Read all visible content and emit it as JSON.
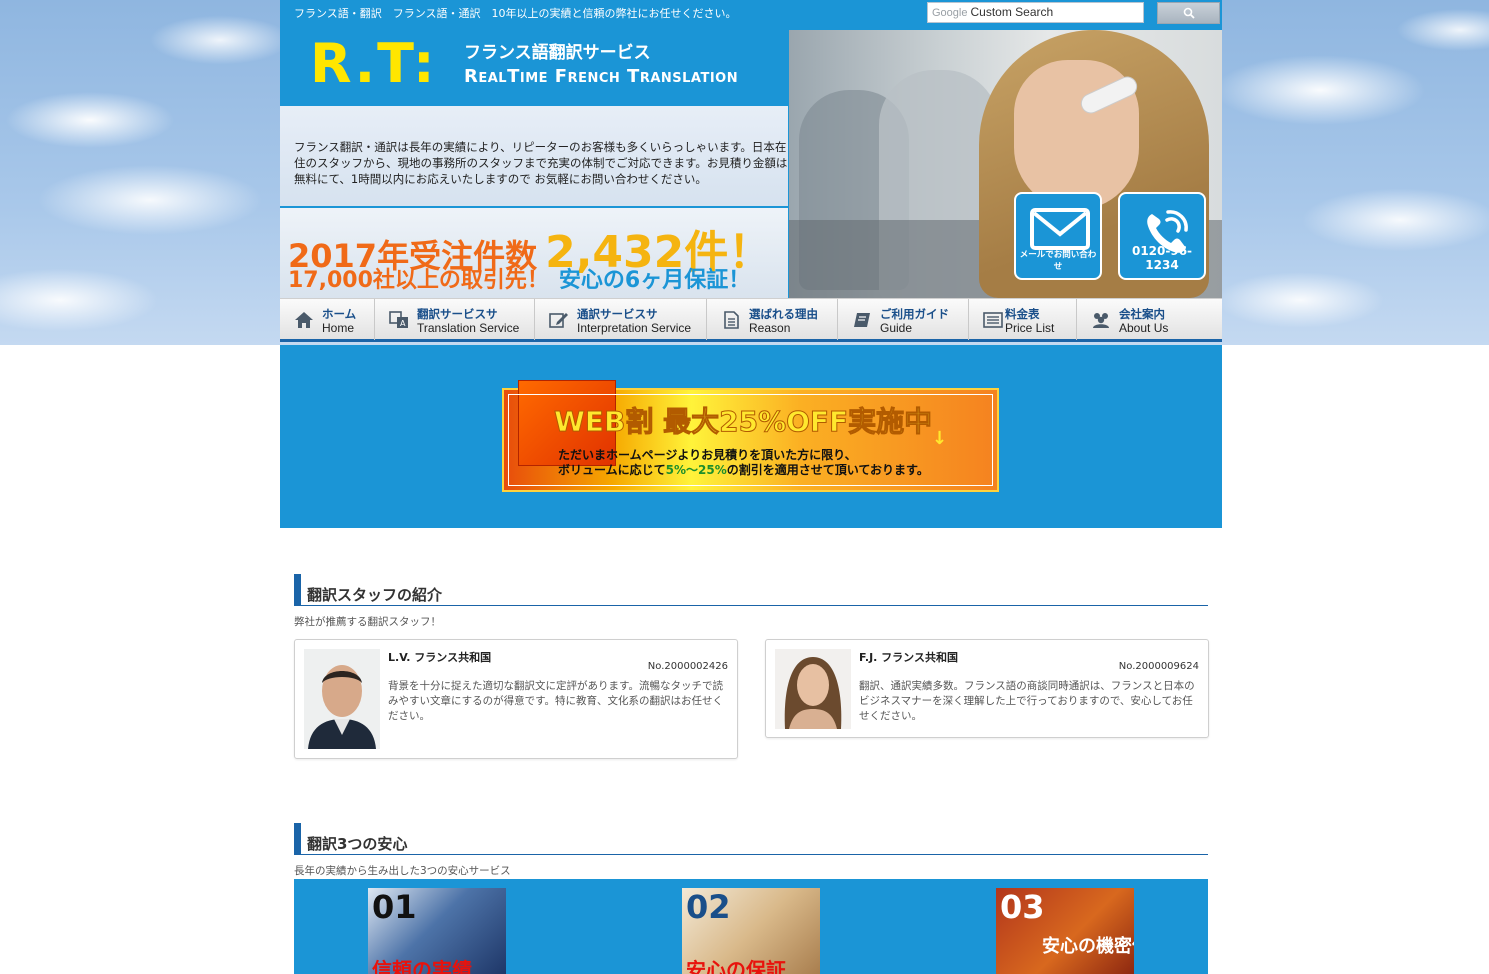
{
  "topbar": {
    "tagline": "フランス語・翻訳　フランス語・通訳　10年以上の実績と信頼の弊社にお任せください。",
    "search_brand": "Google",
    "search_placeholder": "Custom Search",
    "search_button_icon": "search-icon"
  },
  "header": {
    "logo_mark": "R.T:",
    "logo_jp": "フランス語翻訳サービス",
    "logo_en": "RealTime French Translation",
    "intro": "フランス翻訳・通訳は長年の実績により、リピーターのお客様も多くいらっしゃいます。日本在住のスタッフから、現地の事務所のスタッフまで充実の体制でご対応できます。お見積り金額は無料にて、1時間以内にお応えいたしますので お気軽にお問い合わせください。",
    "stat_orders_label": "2017年受注件数",
    "stat_orders_value": "2,432件！",
    "stat_clients": "17,000社以上の取引先！",
    "stat_guarantee": "安心の6ヶ月保証！",
    "mail_label": "メールでお問い合わせ",
    "tel_label": "0120-96-1234"
  },
  "nav": [
    {
      "jp": "ホーム",
      "en": "Home",
      "icon": "home-icon"
    },
    {
      "jp": "翻訳サービスサ",
      "en": "Translation Service",
      "icon": "translate-icon"
    },
    {
      "jp": "通訳サービスサ",
      "en": "Interpretation Service",
      "icon": "edit-icon"
    },
    {
      "jp": "選ばれる理由",
      "en": "Reason",
      "icon": "document-icon"
    },
    {
      "jp": "ご利用ガイド",
      "en": "Guide",
      "icon": "book-icon"
    },
    {
      "jp": "料金表",
      "en": "Price List",
      "icon": "list-icon"
    },
    {
      "jp": "会社案内",
      "en": "About Us",
      "icon": "people-icon"
    }
  ],
  "banner": {
    "title": "WEB割 最大25%OFF実施中",
    "line1": "ただいまホームページよりお見積りを頂いた方に限り、",
    "line2_a": "ボリュームに応じて",
    "line2_b": "5%～25%",
    "line2_c": "の割引を適用させて頂いております。"
  },
  "staff_section": {
    "title": "翻訳スタッフの紹介",
    "subtitle": "弊社が推薦する翻訳スタッフ！",
    "staff": [
      {
        "name": "L.V. フランス共和国",
        "no": "No.2000002426",
        "desc": "背景を十分に捉えた適切な翻訳文に定評があります。流暢なタッチで読みやすい文章にするのが得意です。特に教育、文化系の翻訳はお任せください。"
      },
      {
        "name": "F.J. フランス共和国",
        "no": "No.2000009624",
        "desc": "翻訳、通訳実績多数。フランス語の商談同時通訳は、フランスと日本のビジネスマナーを深く理解した上で行っておりますので、安心してお任せください。"
      }
    ]
  },
  "anshin_section": {
    "title": "翻訳3つの安心",
    "subtitle": "長年の実績から生み出した3つの安心サービス",
    "features": [
      {
        "num": "01",
        "caption": "信頼の実績"
      },
      {
        "num": "02",
        "caption": "安心の保証"
      },
      {
        "num": "03",
        "caption": "安心の機密保持"
      }
    ]
  },
  "colors": {
    "brand_blue": "#1b95d6",
    "nav_accent": "#1a64a8",
    "logo_yellow": "#ffe600",
    "stat_orange": "#f06a18"
  }
}
